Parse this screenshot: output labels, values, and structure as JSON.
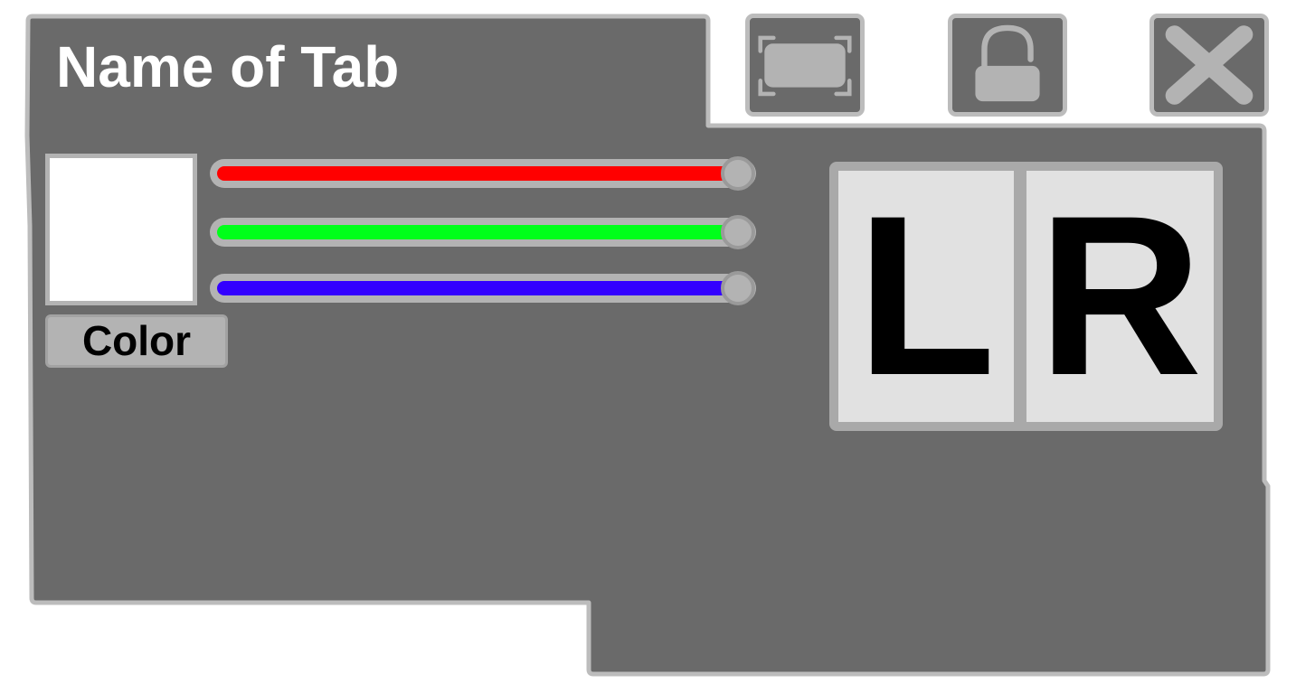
{
  "tab": {
    "title": "Name of Tab"
  },
  "toolbar": {
    "buttons": [
      {
        "name": "expand",
        "icon": "expand-frame-icon"
      },
      {
        "name": "lock",
        "icon": "unlocked-padlock-icon"
      },
      {
        "name": "close",
        "icon": "close-x-icon"
      }
    ]
  },
  "color_picker": {
    "swatch_color": "#ffffff",
    "button_label": "Color",
    "sliders": [
      {
        "channel": "red",
        "color": "#ff0000",
        "value": 1.0
      },
      {
        "channel": "green",
        "color": "#00ff1a",
        "value": 1.0
      },
      {
        "channel": "blue",
        "color": "#3300ff",
        "value": 1.0
      }
    ]
  },
  "lr_toggle": {
    "left_label": "L",
    "right_label": "R"
  },
  "colors": {
    "panel": "#6a6a6a",
    "border": "#bcbcbc",
    "icon": "#b3b3b3"
  }
}
